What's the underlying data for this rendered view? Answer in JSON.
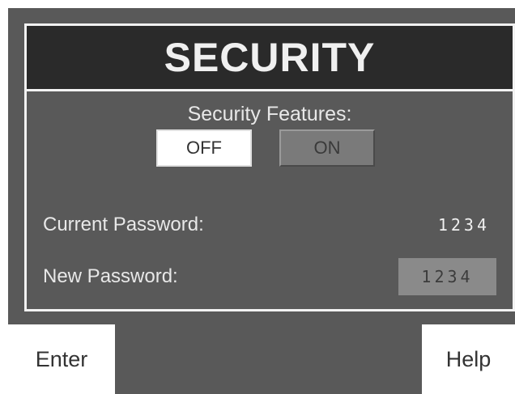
{
  "header": {
    "title": "SECURITY"
  },
  "security_features": {
    "label": "Security Features:",
    "off_label": "OFF",
    "on_label": "ON",
    "selected": "OFF"
  },
  "passwords": {
    "current_label": "Current Password:",
    "current_value": "1234",
    "new_label": "New Password:",
    "new_value": "1234"
  },
  "soft_keys": {
    "enter_label": "Enter",
    "help_label": "Help"
  },
  "colors": {
    "panel_background": "#595959",
    "title_background": "#2a2a2a",
    "frame_border": "#f2f2f2",
    "selected_button": "#ffffff",
    "unselected_button": "#7a7a7a",
    "input_field": "#8a8a8a"
  }
}
